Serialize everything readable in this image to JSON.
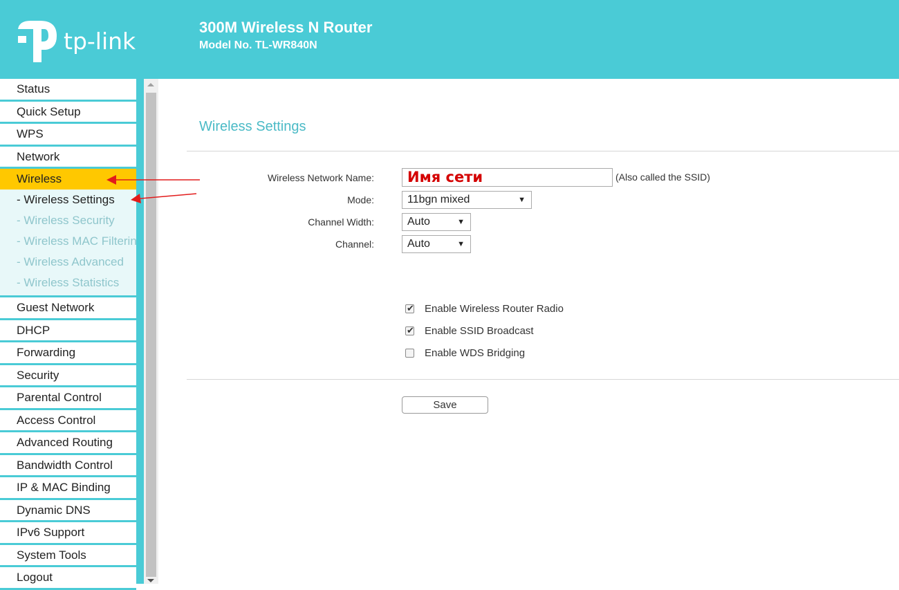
{
  "header": {
    "logo_text": "tp-link",
    "product_name": "300M Wireless N Router",
    "model": "Model No. TL-WR840N",
    "brand_color": "#4acbd6"
  },
  "menu": {
    "items_before": [
      "Status",
      "Quick Setup",
      "WPS",
      "Network"
    ],
    "active": "Wireless",
    "subitems": [
      "- Wireless Settings",
      "- Wireless Security",
      "- Wireless MAC Filtering",
      "- Wireless Advanced",
      "- Wireless Statistics"
    ],
    "current_subitem_index": 0,
    "items_after": [
      "Guest Network",
      "DHCP",
      "Forwarding",
      "Security",
      "Parental Control",
      "Access Control",
      "Advanced Routing",
      "Bandwidth Control",
      "IP & MAC Binding",
      "Dynamic DNS",
      "IPv6 Support",
      "System Tools",
      "Logout"
    ],
    "active_color": "#ffc800"
  },
  "main": {
    "title": "Wireless Settings",
    "ssid_label": "Wireless Network Name:",
    "ssid_value": "Имя сети",
    "ssid_hint": "(Also called the SSID)",
    "mode_label": "Mode:",
    "mode_value": "11bgn mixed",
    "channel_width_label": "Channel Width:",
    "channel_width_value": "Auto",
    "channel_label": "Channel:",
    "channel_value": "Auto",
    "checkboxes": [
      {
        "label": "Enable Wireless Router Radio",
        "checked": true
      },
      {
        "label": "Enable SSID Broadcast",
        "checked": true
      },
      {
        "label": "Enable WDS Bridging",
        "checked": false
      }
    ],
    "save_label": "Save"
  },
  "icons": {
    "logo": "tp-link-logo-icon",
    "caret": "caret-down-icon",
    "annotation": "red-arrow-icon"
  }
}
